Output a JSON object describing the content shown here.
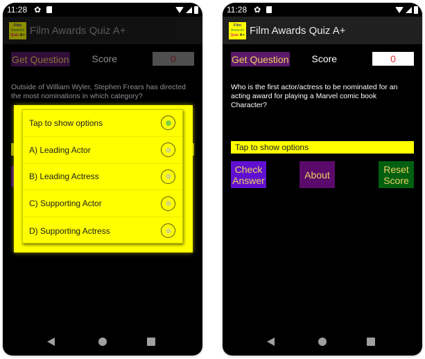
{
  "status_bar": {
    "time": "11:28",
    "icons": [
      "gear-icon",
      "sd-card-icon",
      "wifi-icon",
      "signal-icon",
      "battery-icon"
    ]
  },
  "app": {
    "title": "Film Awards Quiz A+",
    "logo": {
      "line1": "Film",
      "line2": "Awards",
      "line3": "Quiz",
      "line3b": "A+"
    }
  },
  "left_screen": {
    "get_question_label": "Get Question",
    "score_label": "Score",
    "score_value": "0",
    "question": "Outside of William Wyler, Stephen Frears has directed the most nominations in which category?",
    "options_dialog": {
      "options": [
        {
          "label": "Tap to show options",
          "selected": true
        },
        {
          "label": "A) Leading Actor",
          "selected": false
        },
        {
          "label": "B) Leading Actress",
          "selected": false
        },
        {
          "label": "C) Supporting Actor",
          "selected": false
        },
        {
          "label": "D) Supporting Actress",
          "selected": false
        }
      ]
    }
  },
  "right_screen": {
    "get_question_label": "Get Question",
    "score_label": "Score",
    "score_value": "0",
    "question": "Who is the first actor/actress to be nominated for an acting award for playing a Marvel comic book Character?",
    "spinner_text": "Tap to show options",
    "buttons": {
      "check_answer": "Check Answer",
      "about": "About",
      "reset_score": "Reset Score"
    }
  },
  "colors": {
    "accent_yellow": "#ffff00",
    "get_question_bg": "#5a1a6a",
    "button_text": "#f0d060",
    "check_answer_bg": "#6010d0",
    "about_bg": "#5a0a6a",
    "reset_bg": "#006010",
    "score_text": "#e03030"
  }
}
